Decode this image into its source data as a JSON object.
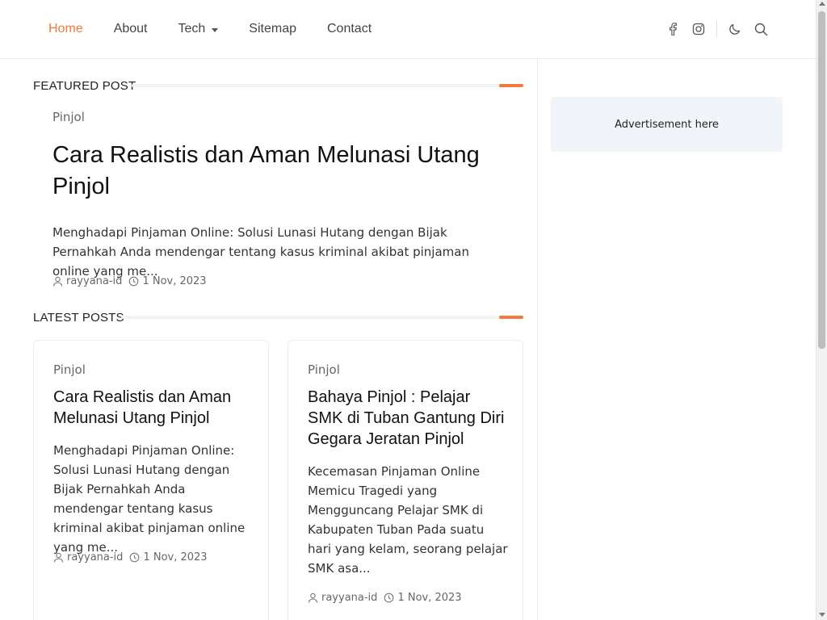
{
  "nav": {
    "items": [
      {
        "label": "Home",
        "active": true
      },
      {
        "label": "About"
      },
      {
        "label": "Tech",
        "has_dropdown": true
      },
      {
        "label": "Sitemap"
      },
      {
        "label": "Contact"
      }
    ],
    "icons": [
      "facebook-icon",
      "instagram-icon",
      "moon-icon",
      "search-icon"
    ]
  },
  "colors": {
    "accent": "#f07b3a",
    "sidebar_bg": "#f1f4f8"
  },
  "featured": {
    "section_title": "FEATURED POST",
    "category": "Pinjol",
    "title": "Cara Realistis dan Aman Melunasi Utang Pinjol",
    "excerpt": "Menghadapi Pinjaman Online: Solusi Lunasi Hutang dengan Bijak Pernahkah Anda mendengar tentang kasus kriminal akibat pinjaman online yang me...",
    "author": "rayyana-id",
    "date": "1 Nov, 2023"
  },
  "latest": {
    "section_title": "LATEST POSTS",
    "posts": [
      {
        "category": "Pinjol",
        "title": "Cara Realistis dan Aman Melunasi Utang Pinjol",
        "excerpt": "Menghadapi Pinjaman Online: Solusi Lunasi Hutang dengan Bijak Pernahkah Anda mendengar tentang kasus kriminal akibat pinjaman online yang me...",
        "author": "rayyana-id",
        "date": "1 Nov, 2023"
      },
      {
        "category": "Pinjol",
        "title": "Bahaya Pinjol : Pelajar SMK di Tuban Gantung Diri Gegara Jeratan Pinjol",
        "excerpt": "Kecemasan Pinjaman Online Memicu Tragedi yang Mengguncang Pelajar SMK di Kabupaten Tuban Pada suatu hari yang kelam, seorang pelajar SMK asa...",
        "author": "rayyana-id",
        "date": "1 Nov, 2023"
      }
    ]
  },
  "sidebar": {
    "ad_text": "Advertisement here"
  }
}
